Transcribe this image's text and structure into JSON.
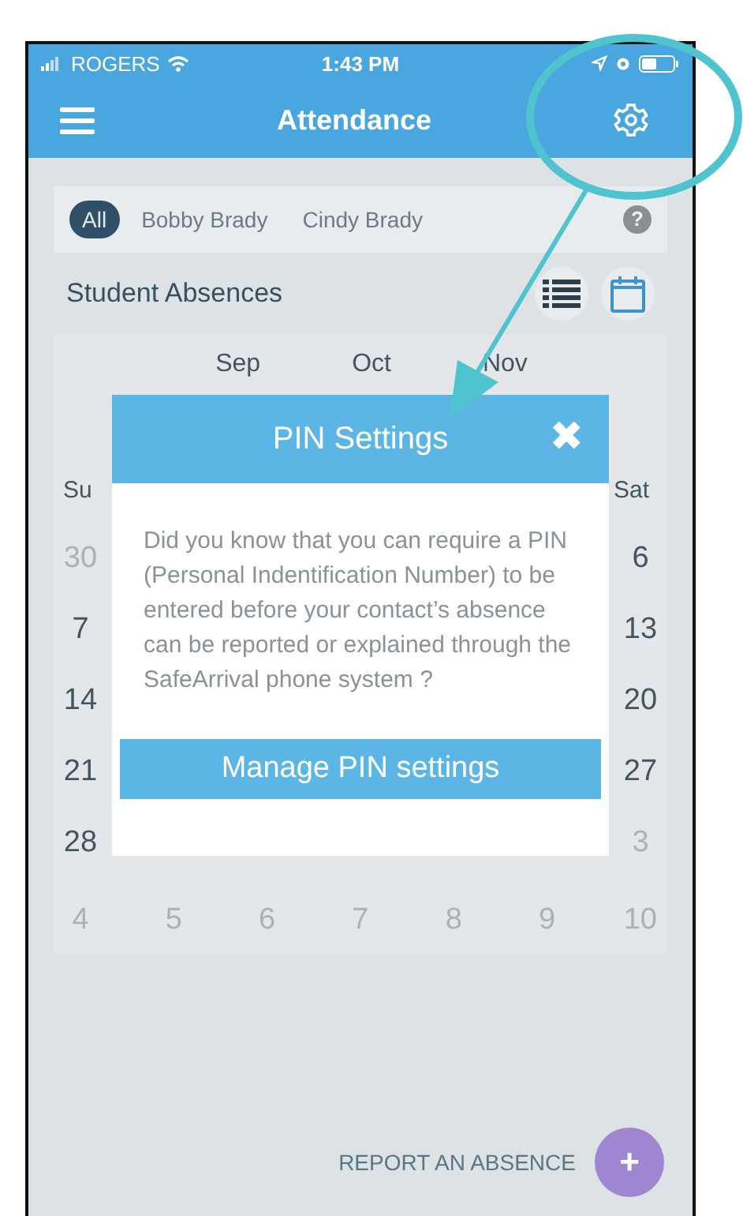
{
  "status_bar": {
    "carrier": "ROGERS",
    "time": "1:43 PM"
  },
  "header": {
    "title": "Attendance"
  },
  "filters": [
    {
      "label": "All",
      "selected": true
    },
    {
      "label": "Bobby Brady",
      "selected": false
    },
    {
      "label": "Cindy Brady",
      "selected": false
    }
  ],
  "help": "?",
  "section": {
    "title": "Student Absences",
    "views": [
      {
        "kind": "list",
        "selected": false
      },
      {
        "kind": "calendar",
        "selected": true
      }
    ]
  },
  "calendar": {
    "months": [
      "Sep",
      "Oct",
      "Nov"
    ],
    "weekday_left": "Su",
    "weekday_right": "Sat",
    "rows": [
      {
        "left": {
          "label": "30",
          "muted": true
        },
        "right": {
          "label": "6",
          "muted": false
        }
      },
      {
        "left": {
          "label": "7",
          "muted": false
        },
        "right": {
          "label": "13",
          "muted": false
        }
      },
      {
        "left": {
          "label": "14",
          "muted": false
        },
        "right": {
          "label": "20",
          "muted": false
        }
      },
      {
        "left": {
          "label": "21",
          "muted": false
        },
        "right": {
          "label": "27",
          "muted": false
        }
      },
      {
        "left": {
          "label": "28",
          "muted": false
        },
        "right": {
          "label": "3",
          "muted": true
        }
      }
    ],
    "last_row": [
      {
        "label": "4",
        "muted": true
      },
      {
        "label": "5",
        "muted": true
      },
      {
        "label": "6",
        "muted": true
      },
      {
        "label": "7",
        "muted": true
      },
      {
        "label": "8",
        "muted": true
      },
      {
        "label": "9",
        "muted": true
      },
      {
        "label": "10",
        "muted": true
      }
    ]
  },
  "dialog": {
    "title": "PIN Settings",
    "close": "✖",
    "body": "Did you know that you can require a PIN (Personal Indentification Number) to be entered before your contact’s absence can be reported or explained through the SafeArrival phone system ?",
    "button": "Manage PIN settings"
  },
  "report": {
    "label": "REPORT AN ABSENCE",
    "button": "+"
  }
}
